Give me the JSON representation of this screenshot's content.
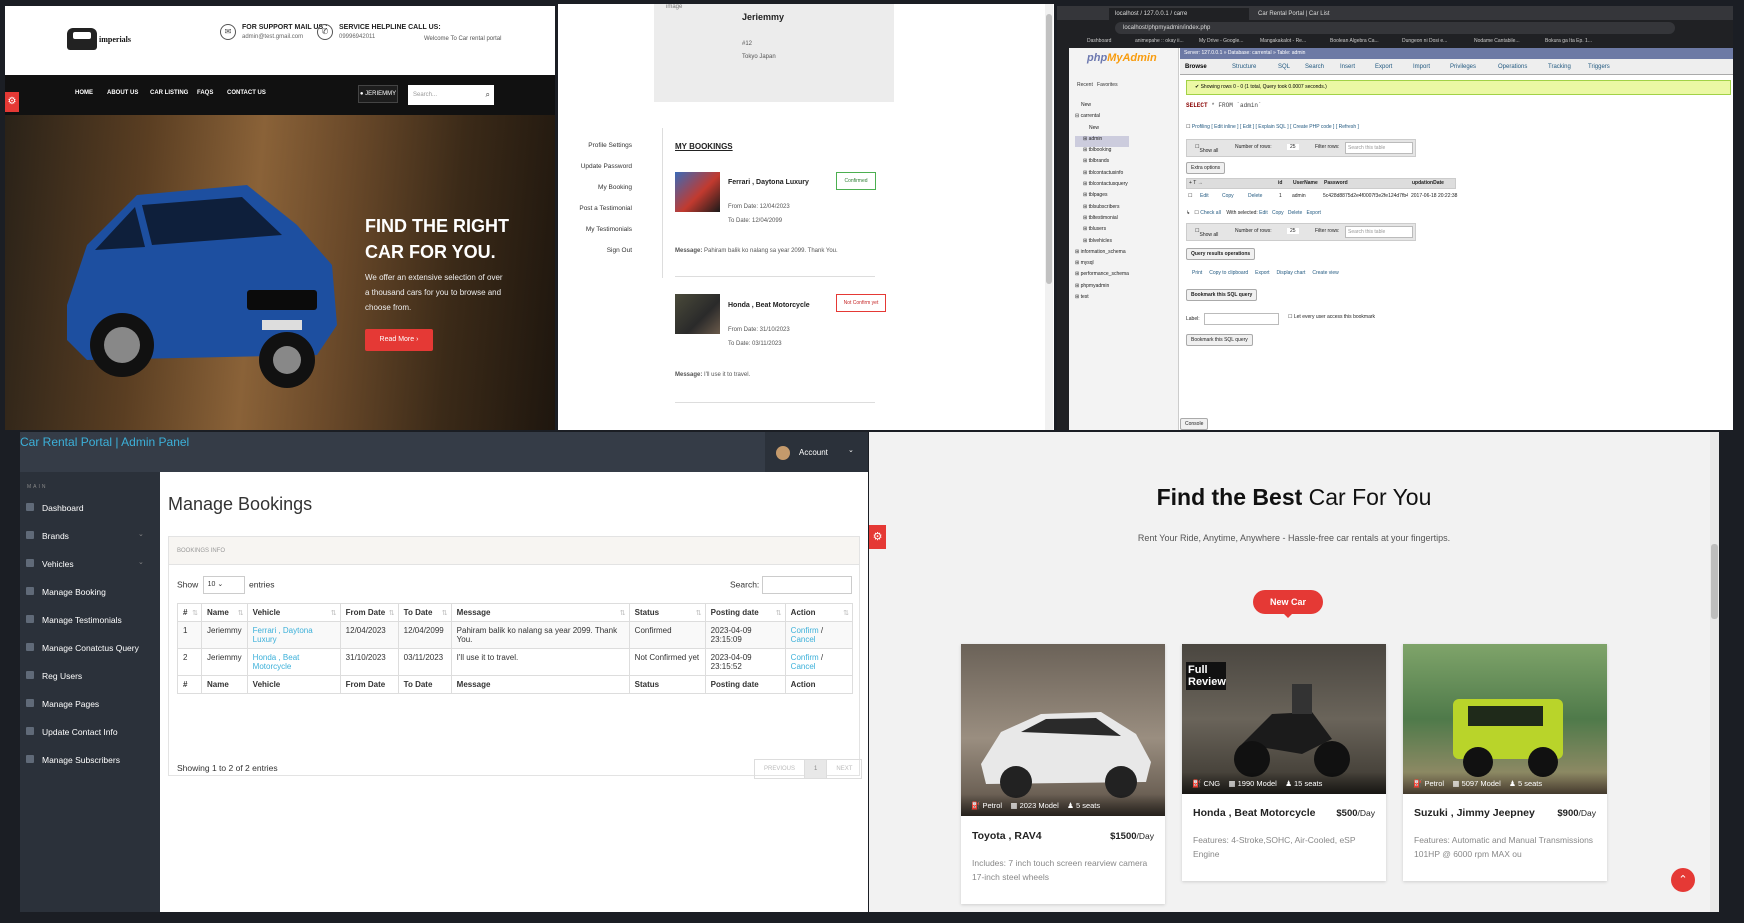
{
  "home": {
    "logo_text": "imperials",
    "support_label": "FOR SUPPORT MAIL US :",
    "support_value": "admin@test.gmail.com",
    "helpline_label": "SERVICE HELPLINE CALL US:",
    "helpline_value": "09996942011",
    "welcome": "Welcome To Car rental portal",
    "nav": [
      "HOME",
      "ABOUT US",
      "CAR LISTING",
      "FAQS",
      "CONTACT US"
    ],
    "user_button": "JERIEMMY",
    "search_placeholder": "Search...",
    "hero_title": "FIND THE RIGHT CAR FOR YOU.",
    "hero_text": "We offer an extensive selection of over a thousand cars for you to browse and choose from.",
    "read_more": "Read More"
  },
  "profile": {
    "image_alt": "image",
    "name": "Jeriemmy",
    "address_line1": "#12",
    "address_line2": "Tokyo Japan",
    "side_menu": [
      "Profile Settings",
      "Update Password",
      "My Booking",
      "Post a Testimonial",
      "My Testimonials",
      "Sign Out"
    ],
    "heading": "MY BOOKINGS",
    "bookings": [
      {
        "title": "Ferrari , Daytona Luxury",
        "from": "From Date: 12/04/2023",
        "to": "To Date: 12/04/2099",
        "status": "Confirmed",
        "message_label": "Message:",
        "message": "Pahiram balik ko nalang sa year 2099. Thank You."
      },
      {
        "title": "Honda , Beat Motorcycle",
        "from": "From Date: 31/10/2023",
        "to": "To Date: 03/11/2023",
        "status": "Not Confirm yet",
        "message_label": "Message:",
        "message": "I'll use it to travel."
      }
    ]
  },
  "pma": {
    "tabs": [
      "localhost / 127.0.0.1 / carre",
      "Car Rental Portal | Car List"
    ],
    "url": "localhost/phpmyadmin/index.php",
    "bookmarks": [
      "Dashboard",
      "animepahe :: okay ii...",
      "My Drive - Google...",
      "Mangakakalot - Re...",
      "Boolean Algebra Ca...",
      "Dungeon ni Dosi e...",
      "Nodame Cantabile...",
      "Bokura ga Ita Ep. 1..."
    ],
    "logo_a": "php",
    "logo_b": "MyAdmin",
    "recent": "Recent",
    "favorites": "Favorites",
    "tree": [
      "New",
      "carrental",
      "New",
      "admin",
      "tblbooking",
      "tblbrands",
      "tblcontactusinfo",
      "tblcontactusquery",
      "tblpages",
      "tblsubscribers",
      "tbltestimonial",
      "tblusers",
      "tblvehicles",
      "information_schema",
      "mysql",
      "performance_schema",
      "phpmyadmin",
      "test"
    ],
    "breadcrumb": "Server: 127.0.0.1 » Database: carrental » Table: admin",
    "menu": [
      "Browse",
      "Structure",
      "SQL",
      "Search",
      "Insert",
      "Export",
      "Import",
      "Privileges",
      "Operations",
      "Tracking",
      "Triggers"
    ],
    "success": "Showing rows 0 - 0 (1 total, Query took 0.0007 seconds.)",
    "sql_select": "SELECT",
    "sql_rest": "* FROM `admin`",
    "profiling": "Profiling [ Edit inline ] [ Edit ] [ Explain SQL ] [ Create PHP code ] [ Refresh ]",
    "show_all": "Show all",
    "num_rows_label": "Number of rows:",
    "num_rows": "25",
    "filter_label": "Filter rows:",
    "filter_placeholder": "Search this table",
    "extra_options": "Extra options",
    "cols": [
      "id",
      "UserName",
      "Password",
      "updationDate"
    ],
    "row": {
      "edit": "Edit",
      "copy": "Copy",
      "delete": "Delete",
      "id": "1",
      "username": "admin",
      "password": "5c428d8875d2e4f0007f3e2fe124d7fb4",
      "date": "2017-06-18 20:22:38"
    },
    "check_all": "Check all",
    "with_selected": "With selected:",
    "bulk": [
      "Edit",
      "Copy",
      "Delete",
      "Export"
    ],
    "qro": "Query results operations",
    "ops": [
      "Print",
      "Copy to clipboard",
      "Export",
      "Display chart",
      "Create view"
    ],
    "bookmark_title": "Bookmark this SQL query",
    "label": "Label:",
    "let_every": "Let every user access this bookmark",
    "bookmark_btn": "Bookmark this SQL query",
    "console": "Console"
  },
  "admin": {
    "brand": "Car Rental Portal | Admin Panel",
    "account": "Account",
    "main_label": "MAIN",
    "menu": [
      {
        "label": "Dashboard",
        "arrow": ""
      },
      {
        "label": "Brands",
        "arrow": "⌄"
      },
      {
        "label": "Vehicles",
        "arrow": "⌄"
      },
      {
        "label": "Manage Booking",
        "arrow": ""
      },
      {
        "label": "Manage Testimonials",
        "arrow": ""
      },
      {
        "label": "Manage Conatctus Query",
        "arrow": ""
      },
      {
        "label": "Reg Users",
        "arrow": ""
      },
      {
        "label": "Manage Pages",
        "arrow": ""
      },
      {
        "label": "Update Contact Info",
        "arrow": ""
      },
      {
        "label": "Manage Subscribers",
        "arrow": ""
      }
    ],
    "title": "Manage Bookings",
    "card_header": "BOOKINGS INFO",
    "show": "Show",
    "entries_value": "10",
    "entries": "entries",
    "search": "Search:",
    "headers": [
      "#",
      "Name",
      "Vehicle",
      "From Date",
      "To Date",
      "Message",
      "Status",
      "Posting date",
      "Action"
    ],
    "rows": [
      {
        "n": "1",
        "name": "Jeriemmy",
        "vehicle": "Ferrari , Daytona Luxury",
        "from": "12/04/2023",
        "to": "12/04/2099",
        "message": "Pahiram balik ko nalang sa year 2099. Thank You.",
        "status": "Confirmed",
        "posting": "2023-04-09 23:15:09",
        "confirm": "Confirm",
        "sep": "/",
        "cancel": "Cancel"
      },
      {
        "n": "2",
        "name": "Jeriemmy",
        "vehicle": "Honda , Beat Motorcycle",
        "from": "31/10/2023",
        "to": "03/11/2023",
        "message": "I'll use it to travel.",
        "status": "Not Confirmed yet",
        "posting": "2023-04-09 23:15:52",
        "confirm": "Confirm",
        "sep": "/",
        "cancel": "Cancel"
      }
    ],
    "showing": "Showing 1 to 2 of 2 entries",
    "prev": "PREVIOUS",
    "page": "1",
    "next": "NEXT"
  },
  "best": {
    "title_bold": "Find the Best",
    "title_rest": "Car For You",
    "subtitle": "Rent Your Ride, Anytime, Anywhere - Hassle-free car rentals at your fingertips.",
    "new_car": "New Car",
    "cars": [
      {
        "name": "Toyota , RAV4",
        "price": "$1500",
        "per": "/Day",
        "fuel": "Petrol",
        "model": "2023 Model",
        "seats": "5 seats",
        "features": "Includes: 7 inch touch screen rearview camera 17-inch steel wheels",
        "photo_text": ""
      },
      {
        "name": "Honda , Beat Motorcycle",
        "price": "$500",
        "per": "/Day",
        "fuel": "CNG",
        "model": "1990 Model",
        "seats": "15 seats",
        "features": "Features: 4-Stroke,SOHC, Air-Cooled, eSP Engine",
        "photo_text": "Full Review"
      },
      {
        "name": "Suzuki , Jimmy Jeepney",
        "price": "$900",
        "per": "/Day",
        "fuel": "Petrol",
        "model": "5097 Model",
        "seats": "5 seats",
        "features": "Features: Automatic and Manual Transmissions 101HP @ 6000 rpm MAX ou",
        "photo_text": ""
      }
    ]
  },
  "colors": {
    "accent_red": "#e53935",
    "admin_link": "#3cb0d9",
    "admin_dark": "#2b313a",
    "pma_success": "#ebf8a4"
  },
  "icons": [
    "car-logo-icon",
    "mail-icon",
    "phone-icon",
    "user-icon",
    "search-icon",
    "gear-icon",
    "chevron-down-icon",
    "arrow-up-icon",
    "fuel-icon",
    "calendar-icon",
    "seat-icon"
  ]
}
